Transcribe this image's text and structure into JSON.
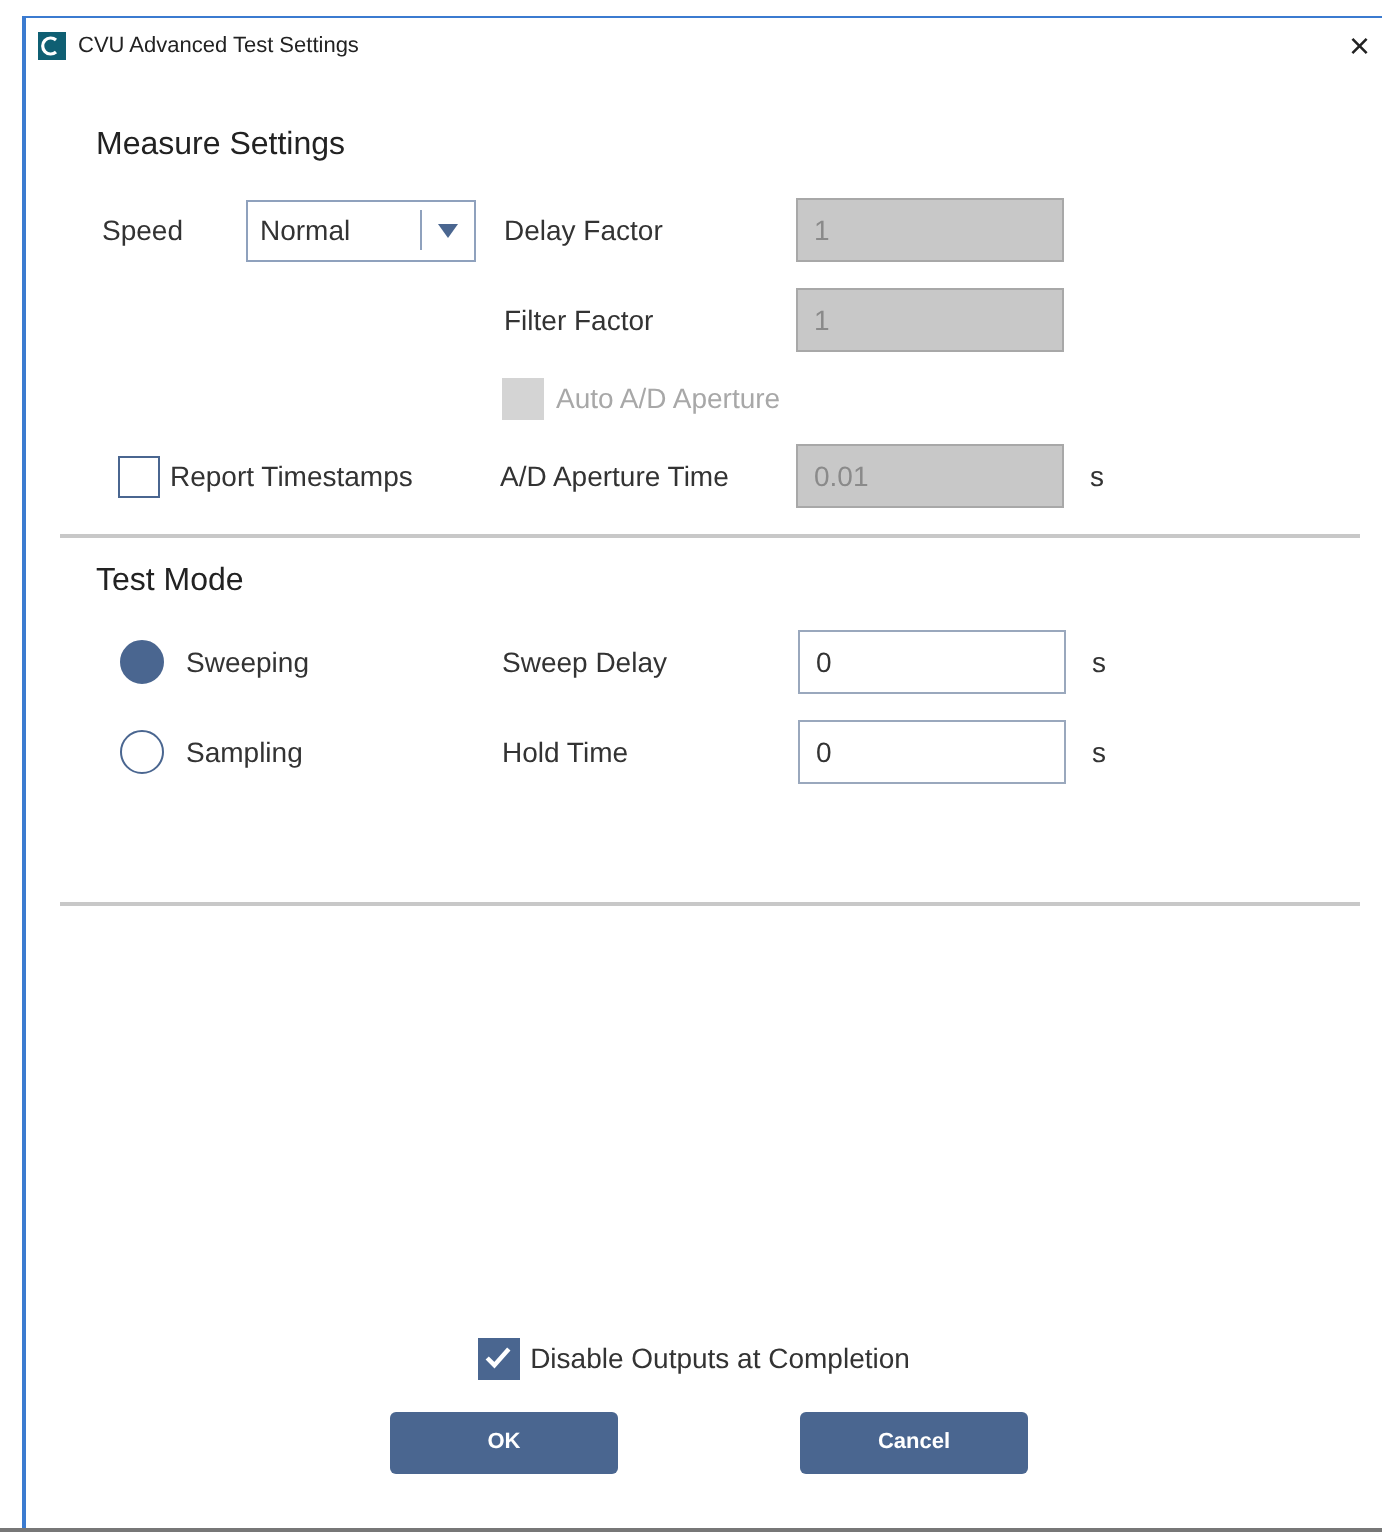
{
  "window": {
    "title": "CVU Advanced Test Settings",
    "close": "×"
  },
  "measure_settings": {
    "heading": "Measure Settings",
    "speed": {
      "label": "Speed",
      "value": "Normal"
    },
    "delay_factor": {
      "label": "Delay Factor",
      "value": "1",
      "disabled": true
    },
    "filter_factor": {
      "label": "Filter Factor",
      "value": "1",
      "disabled": true
    },
    "auto_ad_aperture": {
      "label": "Auto A/D Aperture",
      "checked": false,
      "disabled": true
    },
    "report_timestamps": {
      "label": "Report Timestamps",
      "checked": false
    },
    "ad_aperture_time": {
      "label": "A/D Aperture Time",
      "value": "0.01",
      "unit": "s",
      "disabled": true
    }
  },
  "test_mode": {
    "heading": "Test Mode",
    "modes": [
      {
        "label": "Sweeping",
        "selected": true
      },
      {
        "label": "Sampling",
        "selected": false
      }
    ],
    "fields": [
      {
        "label": "Sweep Delay",
        "value": "0",
        "unit": "s"
      },
      {
        "label": "Hold Time",
        "value": "0",
        "unit": "s"
      }
    ]
  },
  "disable_outputs": {
    "label": "Disable Outputs at Completion",
    "checked": true
  },
  "buttons": [
    "OK",
    "Cancel"
  ]
}
